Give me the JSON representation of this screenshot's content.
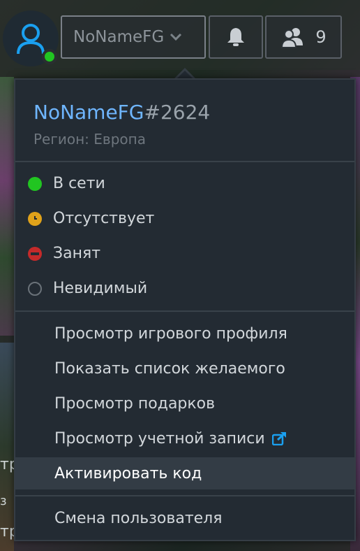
{
  "background": {
    "left_text_1": "тр",
    "left_text_2": "з",
    "left_text_3": "тр"
  },
  "topbar": {
    "username": "NoNameFG",
    "friends_count": "9"
  },
  "profile": {
    "name": "NoNameFG",
    "tag": "#2624",
    "region": "Регион: Европа"
  },
  "statuses": [
    {
      "label": "В сети",
      "color": "#21c521"
    },
    {
      "label": "Отсутствует",
      "color": "#e0a21a"
    },
    {
      "label": "Занят",
      "color": "#c42a2a"
    },
    {
      "label": "Невидимый",
      "color": "#6a7279"
    }
  ],
  "menu": {
    "view_game_profile": "Просмотр игрового профиля",
    "show_wishlist": "Показать список желаемого",
    "view_gifts": "Просмотр подарков",
    "view_account": "Просмотр учетной записи",
    "redeem_code": "Активировать код",
    "switch_user": "Смена пользователя"
  }
}
